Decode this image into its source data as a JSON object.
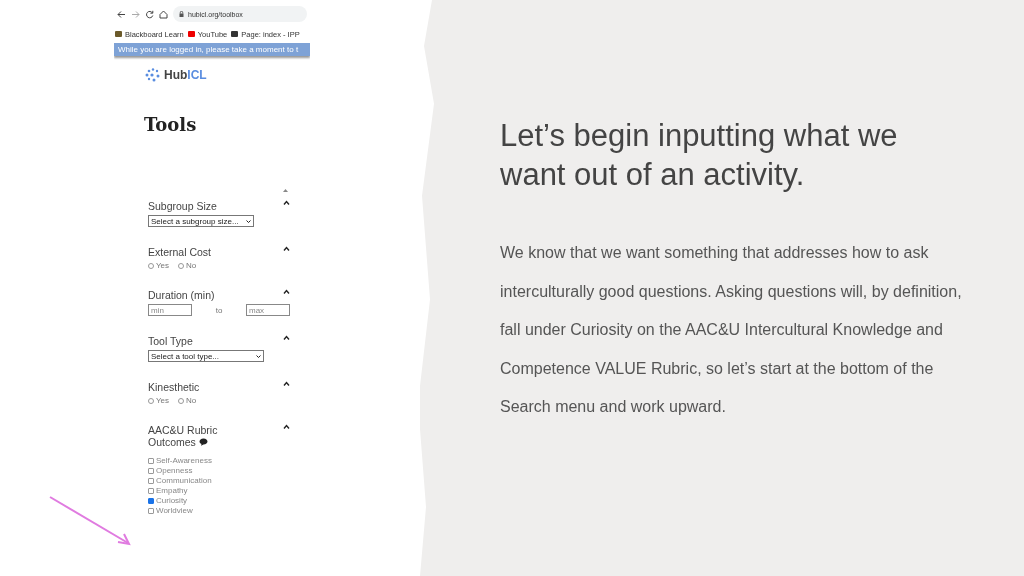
{
  "browser": {
    "url": "hubicl.org/toolbox",
    "bookmarks": [
      {
        "label": "Blackboard Learn"
      },
      {
        "label": "YouTube"
      },
      {
        "label": "Page: index - IPP"
      }
    ],
    "banner": "While you are logged in, please take a moment to t"
  },
  "site": {
    "logo_text": "Hub",
    "logo_accent": "ICL",
    "heading": "Tools"
  },
  "filters": [
    {
      "kind": "select",
      "title": "Subgroup Size",
      "expanded": true,
      "value": "Select a subgroup size..."
    },
    {
      "kind": "radio",
      "title": "External Cost",
      "expanded": true,
      "options": [
        {
          "label": "Yes",
          "selected": false
        },
        {
          "label": "No",
          "selected": false
        }
      ]
    },
    {
      "kind": "range",
      "title": "Duration (min)",
      "expanded": true,
      "from_placeholder": "min",
      "separator": "to",
      "to_placeholder": "max"
    },
    {
      "kind": "select",
      "title": "Tool Type",
      "expanded": true,
      "value": "Select a tool type..."
    },
    {
      "kind": "radio",
      "title": "Kinesthetic",
      "expanded": true,
      "options": [
        {
          "label": "Yes",
          "selected": false
        },
        {
          "label": "No",
          "selected": false
        }
      ]
    },
    {
      "kind": "checkbox",
      "title": "AAC&U Rubric Outcomes",
      "expanded": true,
      "options": [
        {
          "label": "Self-Awareness",
          "checked": false
        },
        {
          "label": "Openness",
          "checked": false
        },
        {
          "label": "Communication",
          "checked": false
        },
        {
          "label": "Empathy",
          "checked": false
        },
        {
          "label": "Curiosity",
          "checked": true
        },
        {
          "label": "Worldview",
          "checked": false
        }
      ]
    }
  ],
  "slide": {
    "title": "Let’s begin inputting what we want out of an activity.",
    "body": "We know that we want something that addresses how to ask interculturally good questions.  Asking questions will, by definition, fall under Curiosity on the AAC&U Intercultural Knowledge and Competence VALUE Rubric, so let’s start at the bottom of the Search menu and work upward."
  }
}
